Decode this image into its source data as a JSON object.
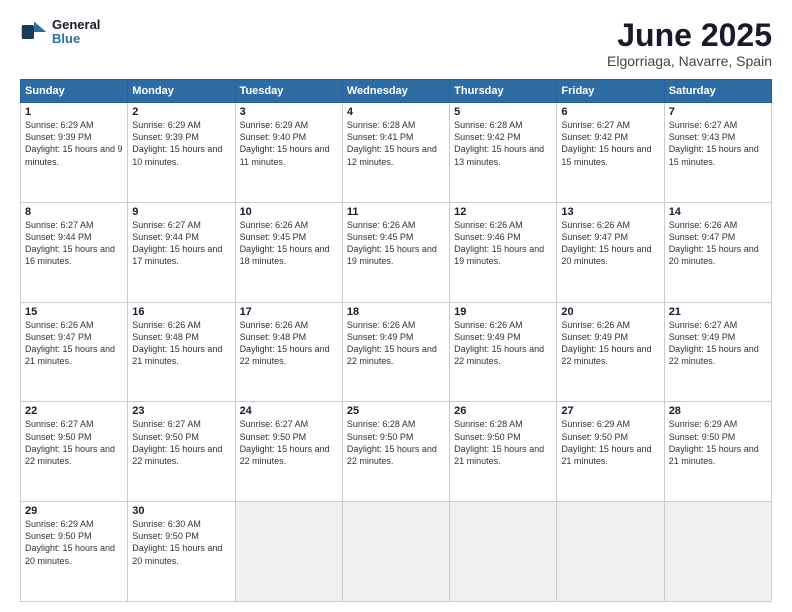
{
  "logo": {
    "line1": "General",
    "line2": "Blue"
  },
  "title": "June 2025",
  "subtitle": "Elgorriaga, Navarre, Spain",
  "header_days": [
    "Sunday",
    "Monday",
    "Tuesday",
    "Wednesday",
    "Thursday",
    "Friday",
    "Saturday"
  ],
  "weeks": [
    [
      {
        "num": "1",
        "rise": "6:29 AM",
        "set": "9:39 PM",
        "daylight": "15 hours and 9 minutes."
      },
      {
        "num": "2",
        "rise": "6:29 AM",
        "set": "9:39 PM",
        "daylight": "15 hours and 10 minutes."
      },
      {
        "num": "3",
        "rise": "6:29 AM",
        "set": "9:40 PM",
        "daylight": "15 hours and 11 minutes."
      },
      {
        "num": "4",
        "rise": "6:28 AM",
        "set": "9:41 PM",
        "daylight": "15 hours and 12 minutes."
      },
      {
        "num": "5",
        "rise": "6:28 AM",
        "set": "9:42 PM",
        "daylight": "15 hours and 13 minutes."
      },
      {
        "num": "6",
        "rise": "6:27 AM",
        "set": "9:42 PM",
        "daylight": "15 hours and 15 minutes."
      },
      {
        "num": "7",
        "rise": "6:27 AM",
        "set": "9:43 PM",
        "daylight": "15 hours and 15 minutes."
      }
    ],
    [
      {
        "num": "8",
        "rise": "6:27 AM",
        "set": "9:44 PM",
        "daylight": "15 hours and 16 minutes."
      },
      {
        "num": "9",
        "rise": "6:27 AM",
        "set": "9:44 PM",
        "daylight": "15 hours and 17 minutes."
      },
      {
        "num": "10",
        "rise": "6:26 AM",
        "set": "9:45 PM",
        "daylight": "15 hours and 18 minutes."
      },
      {
        "num": "11",
        "rise": "6:26 AM",
        "set": "9:45 PM",
        "daylight": "15 hours and 19 minutes."
      },
      {
        "num": "12",
        "rise": "6:26 AM",
        "set": "9:46 PM",
        "daylight": "15 hours and 19 minutes."
      },
      {
        "num": "13",
        "rise": "6:26 AM",
        "set": "9:47 PM",
        "daylight": "15 hours and 20 minutes."
      },
      {
        "num": "14",
        "rise": "6:26 AM",
        "set": "9:47 PM",
        "daylight": "15 hours and 20 minutes."
      }
    ],
    [
      {
        "num": "15",
        "rise": "6:26 AM",
        "set": "9:47 PM",
        "daylight": "15 hours and 21 minutes."
      },
      {
        "num": "16",
        "rise": "6:26 AM",
        "set": "9:48 PM",
        "daylight": "15 hours and 21 minutes."
      },
      {
        "num": "17",
        "rise": "6:26 AM",
        "set": "9:48 PM",
        "daylight": "15 hours and 22 minutes."
      },
      {
        "num": "18",
        "rise": "6:26 AM",
        "set": "9:49 PM",
        "daylight": "15 hours and 22 minutes."
      },
      {
        "num": "19",
        "rise": "6:26 AM",
        "set": "9:49 PM",
        "daylight": "15 hours and 22 minutes."
      },
      {
        "num": "20",
        "rise": "6:26 AM",
        "set": "9:49 PM",
        "daylight": "15 hours and 22 minutes."
      },
      {
        "num": "21",
        "rise": "6:27 AM",
        "set": "9:49 PM",
        "daylight": "15 hours and 22 minutes."
      }
    ],
    [
      {
        "num": "22",
        "rise": "6:27 AM",
        "set": "9:50 PM",
        "daylight": "15 hours and 22 minutes."
      },
      {
        "num": "23",
        "rise": "6:27 AM",
        "set": "9:50 PM",
        "daylight": "15 hours and 22 minutes."
      },
      {
        "num": "24",
        "rise": "6:27 AM",
        "set": "9:50 PM",
        "daylight": "15 hours and 22 minutes."
      },
      {
        "num": "25",
        "rise": "6:28 AM",
        "set": "9:50 PM",
        "daylight": "15 hours and 22 minutes."
      },
      {
        "num": "26",
        "rise": "6:28 AM",
        "set": "9:50 PM",
        "daylight": "15 hours and 21 minutes."
      },
      {
        "num": "27",
        "rise": "6:29 AM",
        "set": "9:50 PM",
        "daylight": "15 hours and 21 minutes."
      },
      {
        "num": "28",
        "rise": "6:29 AM",
        "set": "9:50 PM",
        "daylight": "15 hours and 21 minutes."
      }
    ],
    [
      {
        "num": "29",
        "rise": "6:29 AM",
        "set": "9:50 PM",
        "daylight": "15 hours and 20 minutes."
      },
      {
        "num": "30",
        "rise": "6:30 AM",
        "set": "9:50 PM",
        "daylight": "15 hours and 20 minutes."
      },
      null,
      null,
      null,
      null,
      null
    ]
  ]
}
